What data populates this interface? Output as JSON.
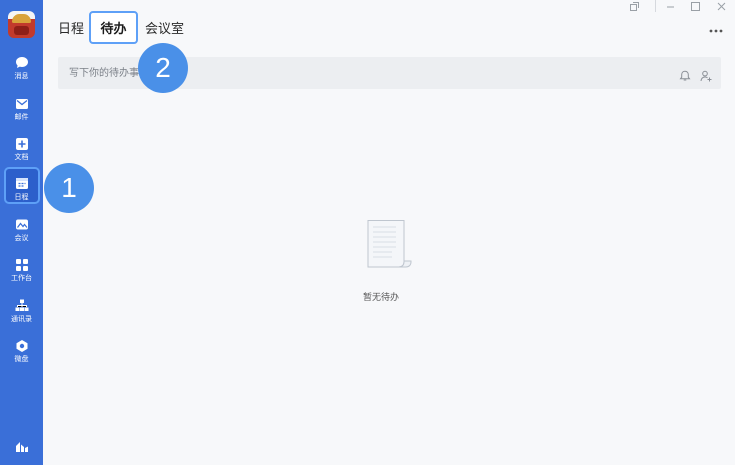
{
  "sidebar": {
    "items": [
      {
        "label": "消息",
        "icon": "chat-bubble-icon"
      },
      {
        "label": "邮件",
        "icon": "mail-icon"
      },
      {
        "label": "文档",
        "icon": "document-plus-icon"
      },
      {
        "label": "日程",
        "icon": "calendar-icon"
      },
      {
        "label": "会议",
        "icon": "video-meeting-icon"
      },
      {
        "label": "工作台",
        "icon": "grid-apps-icon"
      },
      {
        "label": "通讯录",
        "icon": "org-chart-icon"
      },
      {
        "label": "微盘",
        "icon": "cloud-drive-icon"
      }
    ],
    "active": "日程",
    "bottom_icon": "stats-icon"
  },
  "tabs": {
    "schedule": "日程",
    "todo": "待办",
    "meeting_room": "会议室"
  },
  "todo_input": {
    "placeholder": "写下你的待办事项"
  },
  "empty_state": {
    "text": "暂无待办"
  },
  "callouts": {
    "one": "1",
    "two": "2"
  },
  "colors": {
    "sidebar": "#3a6fd8",
    "accent": "#4a90e8",
    "highlight_border": "#5ea0f7"
  }
}
